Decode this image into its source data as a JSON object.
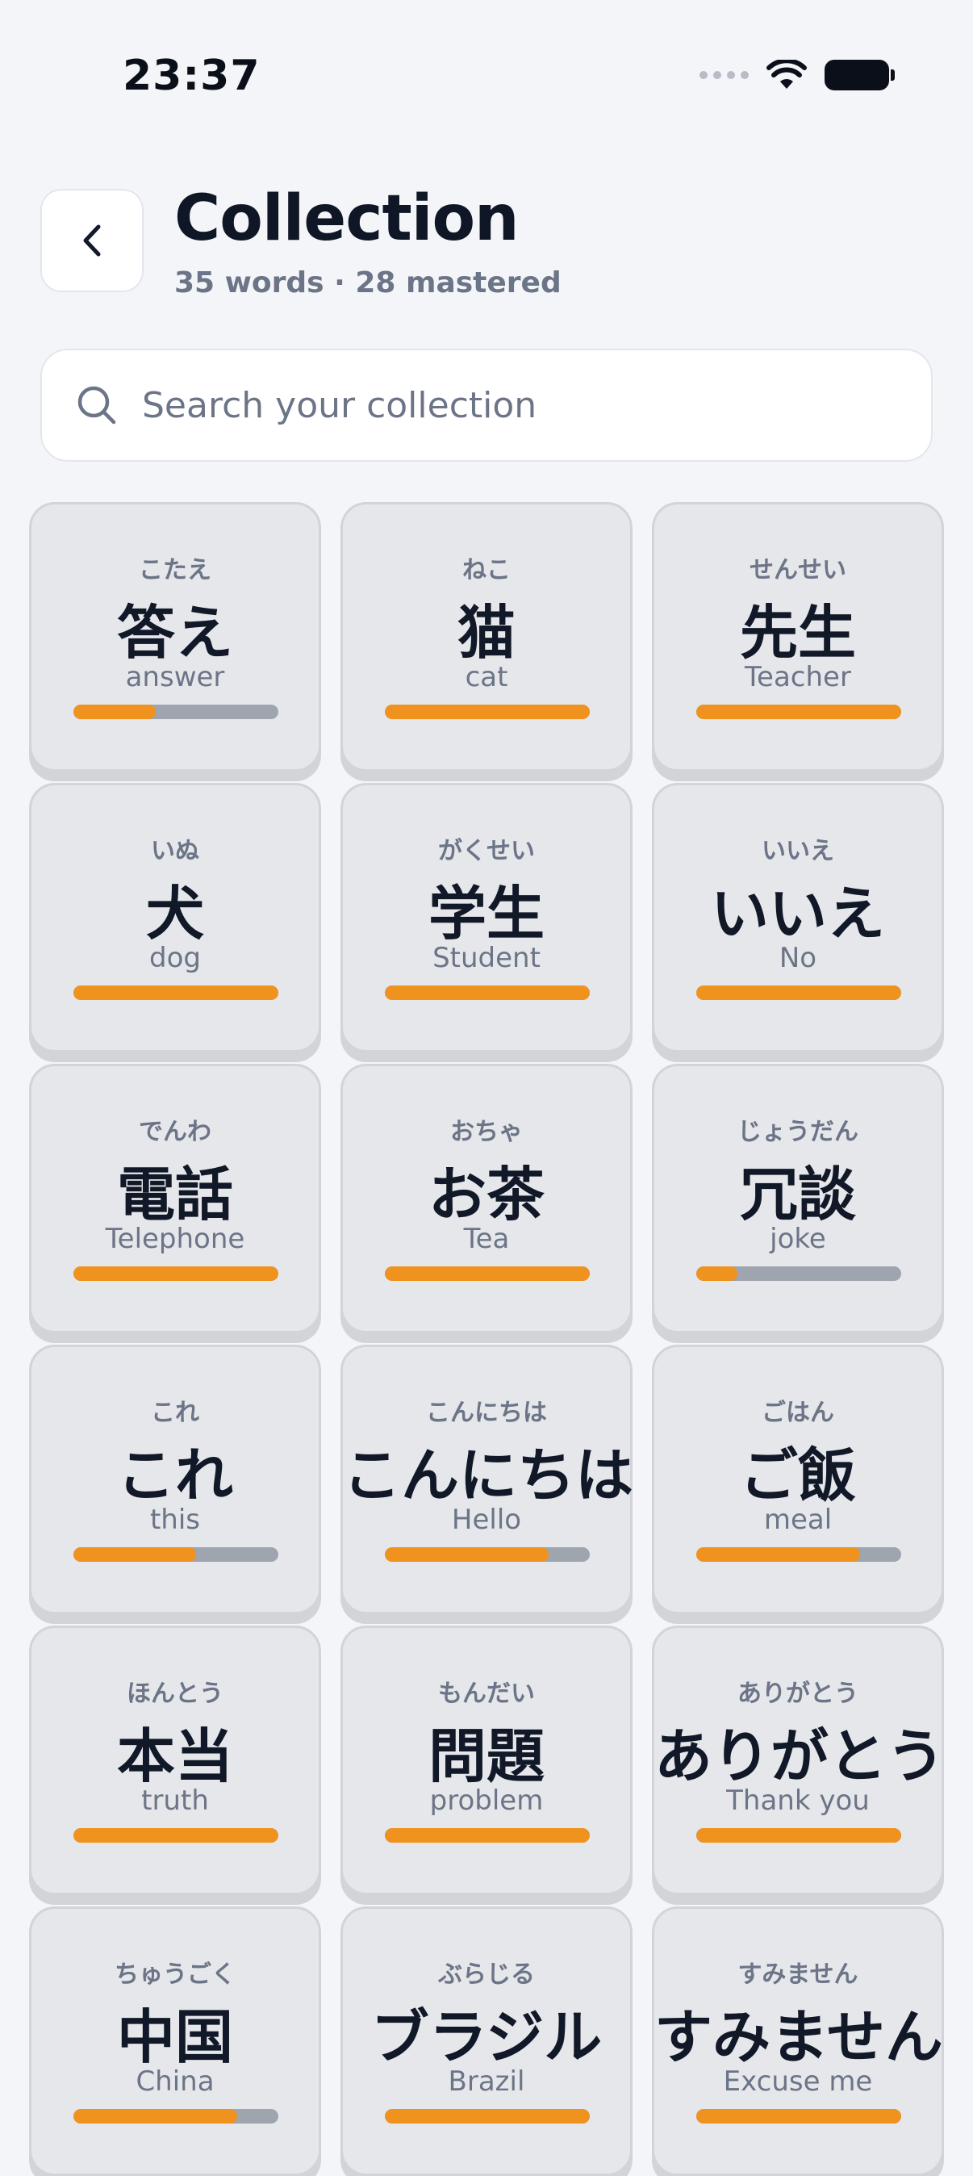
{
  "status_bar": {
    "time": "23:37"
  },
  "header": {
    "title": "Collection",
    "subtitle": "35 words · 28 mastered"
  },
  "search": {
    "placeholder": "Search your collection"
  },
  "colors": {
    "accent": "#f0921e",
    "track": "#9fa5ae",
    "card_bg": "#e6e7eb"
  },
  "words": [
    {
      "reading": "こたえ",
      "word": "答え",
      "meaning": "answer",
      "progress": 0.4
    },
    {
      "reading": "ねこ",
      "word": "猫",
      "meaning": "cat",
      "progress": 1.0
    },
    {
      "reading": "せんせい",
      "word": "先生",
      "meaning": "Teacher",
      "progress": 1.0
    },
    {
      "reading": "いぬ",
      "word": "犬",
      "meaning": "dog",
      "progress": 1.0
    },
    {
      "reading": "がくせい",
      "word": "学生",
      "meaning": "Student",
      "progress": 1.0
    },
    {
      "reading": "いいえ",
      "word": "いいえ",
      "meaning": "No",
      "progress": 1.0
    },
    {
      "reading": "でんわ",
      "word": "電話",
      "meaning": "Telephone",
      "progress": 1.0
    },
    {
      "reading": "おちゃ",
      "word": "お茶",
      "meaning": "Tea",
      "progress": 1.0
    },
    {
      "reading": "じょうだん",
      "word": "冗談",
      "meaning": "joke",
      "progress": 0.2
    },
    {
      "reading": "これ",
      "word": "これ",
      "meaning": "this",
      "progress": 0.6
    },
    {
      "reading": "こんにちは",
      "word": "こんにちは",
      "meaning": "Hello",
      "progress": 0.8
    },
    {
      "reading": "ごはん",
      "word": "ご飯",
      "meaning": "meal",
      "progress": 0.8
    },
    {
      "reading": "ほんとう",
      "word": "本当",
      "meaning": "truth",
      "progress": 1.0
    },
    {
      "reading": "もんだい",
      "word": "問題",
      "meaning": "problem",
      "progress": 1.0
    },
    {
      "reading": "ありがとう",
      "word": "ありがとう",
      "meaning": "Thank you",
      "progress": 1.0
    },
    {
      "reading": "ちゅうごく",
      "word": "中国",
      "meaning": "China",
      "progress": 0.8
    },
    {
      "reading": "ぶらじる",
      "word": "ブラジル",
      "meaning": "Brazil",
      "progress": 1.0
    },
    {
      "reading": "すみません",
      "word": "すみません",
      "meaning": "Excuse me",
      "progress": 1.0
    }
  ]
}
